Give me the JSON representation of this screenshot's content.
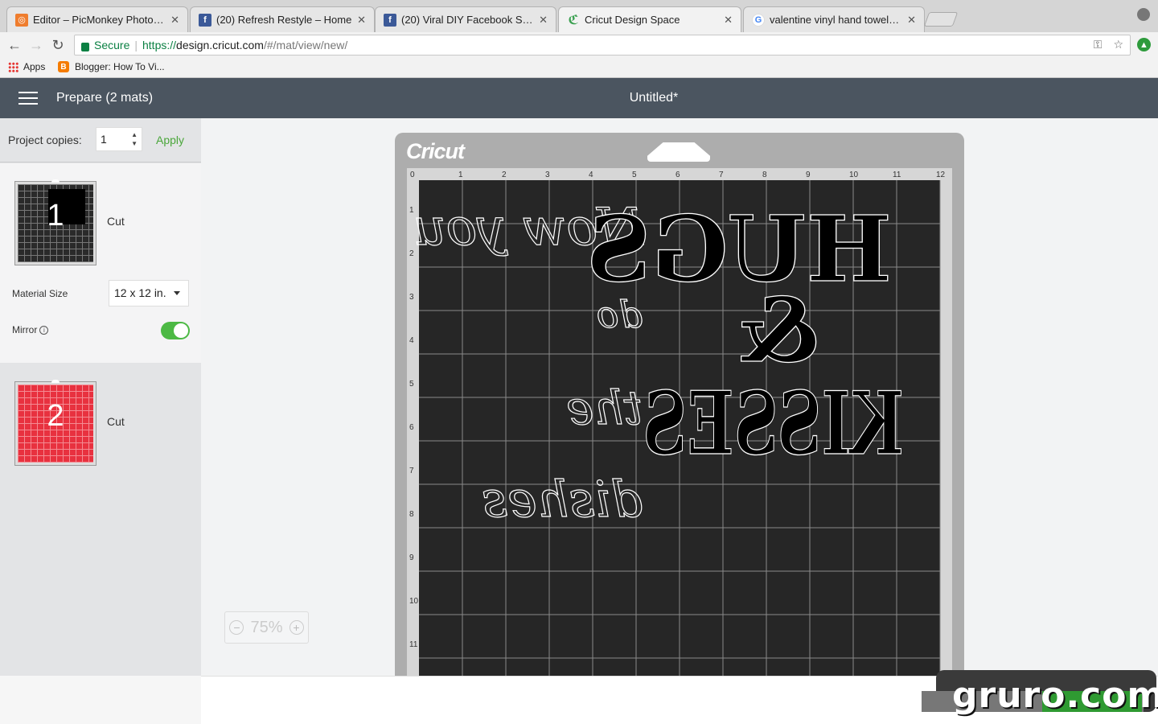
{
  "browser": {
    "tabs": [
      {
        "title": "Editor – PicMonkey Photo Editor",
        "icon": "picmonkey-icon"
      },
      {
        "title": "(20) Refresh Restyle – Home",
        "icon": "facebook-icon"
      },
      {
        "title": "(20) Viral DIY Facebook Sharing",
        "icon": "facebook-icon"
      },
      {
        "title": "Cricut Design Space",
        "icon": "cricut-icon"
      },
      {
        "title": "valentine vinyl hand towels –",
        "icon": "google-icon"
      }
    ],
    "address": {
      "secure_label": "Secure",
      "scheme": "https://",
      "host": "design.cricut.com",
      "path": "/#/mat/view/new/"
    },
    "bookmarks": {
      "apps": "Apps",
      "blogger": "Blogger: How To Vi..."
    }
  },
  "app": {
    "title": "Prepare (2 mats)",
    "document_title": "Untitled*"
  },
  "left_panel": {
    "copies_label": "Project copies:",
    "copies_value": "1",
    "apply_label": "Apply",
    "mats": [
      {
        "number": "1",
        "action": "Cut",
        "color": "#2a2a2a"
      },
      {
        "number": "2",
        "action": "Cut",
        "color": "#e8313f"
      }
    ],
    "material_size_label": "Material Size",
    "material_size_value": "12 x 12 in.",
    "mirror_label": "Mirror",
    "mirror_on": true
  },
  "canvas": {
    "brand": "Cricut",
    "zoom": "75%",
    "ruler_top": [
      "0",
      "1",
      "2",
      "3",
      "4",
      "5",
      "6",
      "7",
      "8",
      "9",
      "10",
      "11",
      "12"
    ],
    "ruler_left": [
      "1",
      "2",
      "3",
      "4",
      "5",
      "6",
      "7",
      "8",
      "9",
      "10",
      "11"
    ],
    "mat_text": {
      "script_words": [
        "Now you",
        "do",
        "the",
        "dishes"
      ],
      "block_words": [
        "HUGS",
        "&",
        "KISSES"
      ]
    }
  },
  "watermark": "gruro.com",
  "colors": {
    "accent_green": "#4aa63a",
    "header": "#4b5560",
    "mat_red": "#e8313f"
  }
}
